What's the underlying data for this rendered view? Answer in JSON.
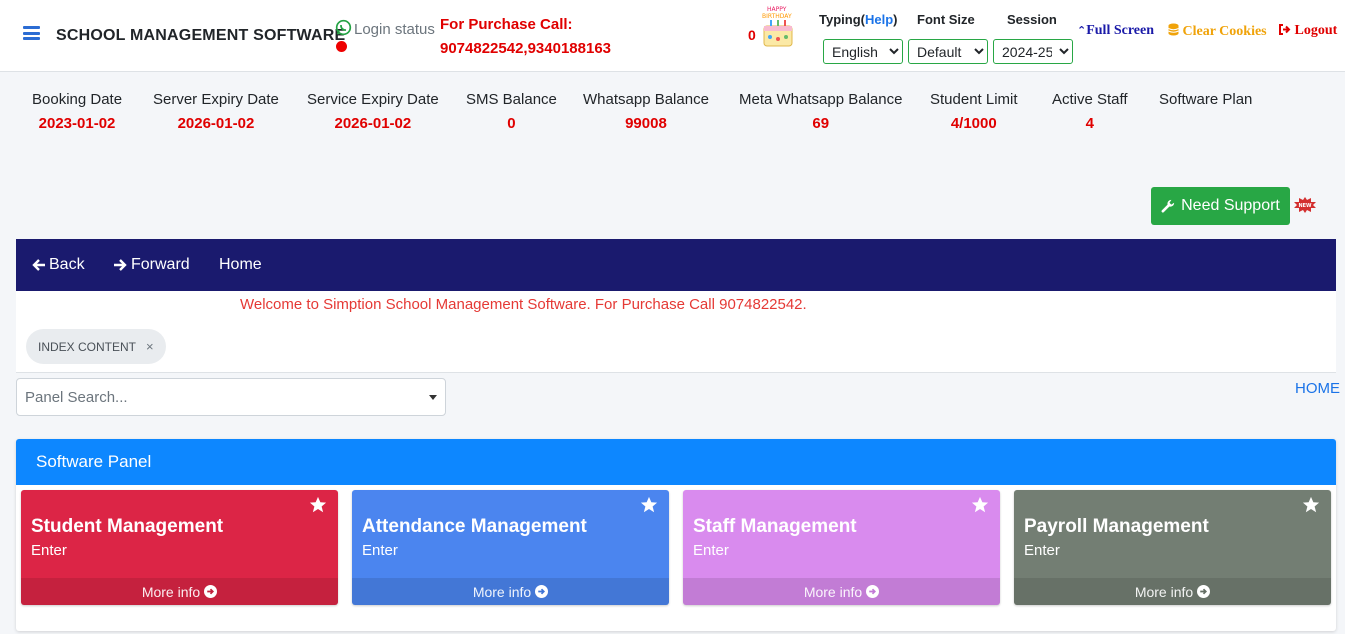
{
  "header": {
    "title": "SCHOOL MANAGEMENT SOFTWARE",
    "login_status": "Login status",
    "purchase_label": "For Purchase Call:",
    "purchase_numbers": "9074822542,9340188163",
    "birthday_count": "0",
    "typing_label": "Typing(",
    "help_label": "Help",
    "typing_close": ")",
    "font_size_label": "Font Size",
    "session_label": "Session",
    "typing_value": "English",
    "font_size_value": "Default",
    "session_value": "2024-25",
    "full_screen": "Full Screen",
    "clear_cookies": "Clear Cookies",
    "logout": "Logout"
  },
  "stats": [
    {
      "label": "Booking Date",
      "value": "2023-01-02"
    },
    {
      "label": "Server Expiry Date",
      "value": "2026-01-02"
    },
    {
      "label": "Service Expiry Date",
      "value": "2026-01-02"
    },
    {
      "label": "SMS Balance",
      "value": "0"
    },
    {
      "label": "Whatsapp Balance",
      "value": "99008"
    },
    {
      "label": "Meta Whatsapp Balance",
      "value": "69"
    },
    {
      "label": "Student Limit",
      "value": "4/1000"
    },
    {
      "label": "Active Staff",
      "value": "4"
    },
    {
      "label": "Software Plan",
      "value": ""
    }
  ],
  "support_button": "Need Support",
  "nav": {
    "back": "Back",
    "forward": "Forward",
    "home": "Home"
  },
  "marquee": "Welcome to Simption School Management Software. For Purchase Call 9074822542.",
  "tab_chip": "INDEX CONTENT",
  "panel_search_placeholder": "Panel Search...",
  "home_link": "HOME",
  "panel": {
    "title": "Software Panel",
    "boxes": [
      {
        "title": "Student Management",
        "sub": "Enter",
        "more": "More info",
        "color": "#dc2546"
      },
      {
        "title": "Attendance Management",
        "sub": "Enter",
        "more": "More info",
        "color": "#4b85ef"
      },
      {
        "title": "Staff Management",
        "sub": "Enter",
        "more": "More info",
        "color": "#d98bee"
      },
      {
        "title": "Payroll Management",
        "sub": "Enter",
        "more": "More info",
        "color": "#737e73"
      }
    ]
  },
  "colors": {
    "accent_red": "#e00000",
    "navbar": "#1a1a6e",
    "panel_header": "#0d87ff",
    "support_green": "#28a745"
  }
}
